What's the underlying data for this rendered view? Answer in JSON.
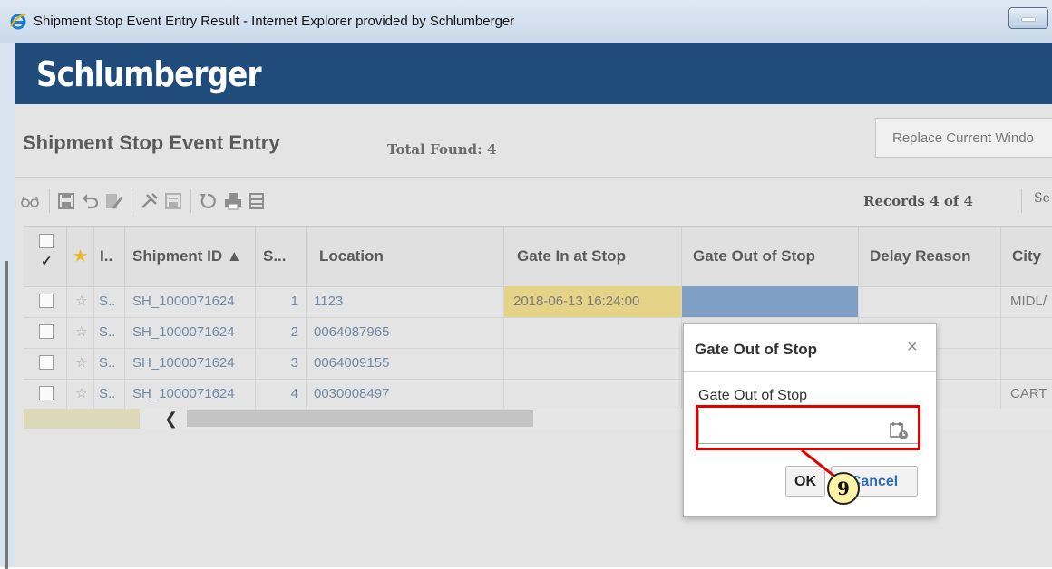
{
  "window": {
    "title": "Shipment Stop Event Entry Result - Internet Explorer provided by Schlumberger"
  },
  "header": {
    "logo_text": "Schlumberger"
  },
  "page": {
    "title": "Shipment Stop Event Entry",
    "total_found": "Total Found: 4",
    "window_mode": "Replace Current Windo"
  },
  "toolbar": {
    "icons": [
      "glasses-icon",
      "save-icon",
      "undo-icon",
      "edit-icon",
      "tools-icon",
      "form-icon",
      "refresh-icon",
      "print-icon",
      "list-icon"
    ],
    "records": "Records 4 of 4",
    "se_button": "Se"
  },
  "grid": {
    "headers": {
      "i": "I..",
      "shipment_id": "Shipment ID ▲",
      "s": "S...",
      "location": "Location",
      "gate_in": "Gate In at Stop",
      "gate_out": "Gate Out of Stop",
      "delay_reason": "Delay Reason",
      "city": "City"
    },
    "rows": [
      {
        "i": "S..",
        "shipment_id": "SH_1000071624",
        "s": "1",
        "location": "1123",
        "gate_in": "2018-06-13 16:24:00",
        "gate_out": "",
        "delay_reason": "",
        "city": "MIDL/"
      },
      {
        "i": "S..",
        "shipment_id": "SH_1000071624",
        "s": "2",
        "location": "0064087965",
        "gate_in": "",
        "gate_out": "",
        "delay_reason": "",
        "city": ""
      },
      {
        "i": "S..",
        "shipment_id": "SH_1000071624",
        "s": "3",
        "location": "0064009155",
        "gate_in": "",
        "gate_out": "",
        "delay_reason": "",
        "city": ""
      },
      {
        "i": "S..",
        "shipment_id": "SH_1000071624",
        "s": "4",
        "location": "0030008497",
        "gate_in": "",
        "gate_out": "",
        "delay_reason": "",
        "city": "CART"
      }
    ],
    "scroll_left_arrow": "❮"
  },
  "dialog": {
    "title": "Gate Out of Stop",
    "close": "×",
    "field_label": "Gate Out of Stop",
    "field_value": "",
    "ok_label": "OK",
    "cancel_label": "Cancel"
  },
  "annotation": {
    "step_number": "9",
    "color": "#e00000"
  }
}
